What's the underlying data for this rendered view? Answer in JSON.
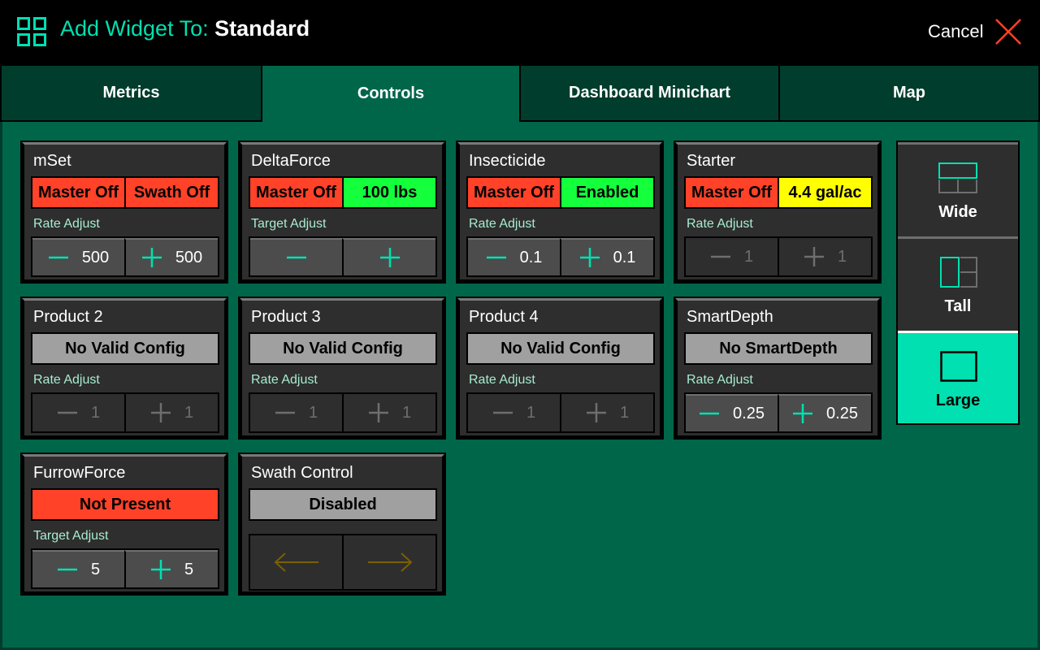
{
  "header": {
    "title_prefix": "Add Widget To: ",
    "title_target": "Standard",
    "cancel_label": "Cancel",
    "icons": {
      "logo": "grid-icon",
      "cancel": "close-x-icon"
    },
    "colors": {
      "accent": "#00e0b0",
      "cancel_x": "#ff4228"
    }
  },
  "tabs": [
    {
      "label": "Metrics",
      "active": false
    },
    {
      "label": "Controls",
      "active": true
    },
    {
      "label": "Dashboard Minichart",
      "active": false
    },
    {
      "label": "Map",
      "active": false
    }
  ],
  "colors": {
    "status_red": "#ff4228",
    "status_green": "#14ff3c",
    "status_yellow": "#ffff00",
    "status_gray": "#a0a0a0",
    "adjust_icon": "#00e0b0",
    "adjust_icon_disabled": "#6e6e6e",
    "arrow_disabled": "#7a6000"
  },
  "widgets": [
    {
      "name": "mSet",
      "status": [
        {
          "text": "Master Off",
          "color": "red"
        },
        {
          "text": "Swath Off",
          "color": "red"
        }
      ],
      "adjust_label": "Rate Adjust",
      "minus": "500",
      "plus": "500",
      "enabled": true
    },
    {
      "name": "DeltaForce",
      "status": [
        {
          "text": "Master Off",
          "color": "red"
        },
        {
          "text": "100 lbs",
          "color": "green"
        }
      ],
      "adjust_label": "Target Adjust",
      "minus": "",
      "plus": "",
      "enabled": true
    },
    {
      "name": "Insecticide",
      "status": [
        {
          "text": "Master Off",
          "color": "red"
        },
        {
          "text": "Enabled",
          "color": "green"
        }
      ],
      "adjust_label": "Rate Adjust",
      "minus": "0.1",
      "plus": "0.1",
      "enabled": true
    },
    {
      "name": "Starter",
      "status": [
        {
          "text": "Master Off",
          "color": "red"
        },
        {
          "text": "4.4 gal/ac",
          "color": "yellow"
        }
      ],
      "adjust_label": "Rate Adjust",
      "minus": "1",
      "plus": "1",
      "enabled": false
    },
    {
      "name": "Product 2",
      "status": [
        {
          "text": "No Valid Config",
          "color": "gray"
        }
      ],
      "adjust_label": "Rate Adjust",
      "minus": "1",
      "plus": "1",
      "enabled": false
    },
    {
      "name": "Product 3",
      "status": [
        {
          "text": "No Valid Config",
          "color": "gray"
        }
      ],
      "adjust_label": "Rate Adjust",
      "minus": "1",
      "plus": "1",
      "enabled": false
    },
    {
      "name": "Product 4",
      "status": [
        {
          "text": "No Valid Config",
          "color": "gray"
        }
      ],
      "adjust_label": "Rate Adjust",
      "minus": "1",
      "plus": "1",
      "enabled": false
    },
    {
      "name": "SmartDepth",
      "status": [
        {
          "text": "No SmartDepth",
          "color": "gray"
        }
      ],
      "adjust_label": "Rate Adjust",
      "minus": "0.25",
      "plus": "0.25",
      "enabled": true
    },
    {
      "name": "FurrowForce",
      "status": [
        {
          "text": "Not Present",
          "color": "red"
        }
      ],
      "adjust_label": "Target Adjust",
      "minus": "5",
      "plus": "5",
      "enabled": true
    },
    {
      "name": "Swath Control",
      "status": [
        {
          "text": "Disabled",
          "color": "gray"
        }
      ],
      "arrows": [
        "arrow-left-icon",
        "arrow-right-icon"
      ]
    }
  ],
  "sizes": [
    {
      "label": "Wide",
      "icon": "wide-layout-icon",
      "active": false
    },
    {
      "label": "Tall",
      "icon": "tall-layout-icon",
      "active": false
    },
    {
      "label": "Large",
      "icon": "large-layout-icon",
      "active": true
    }
  ]
}
